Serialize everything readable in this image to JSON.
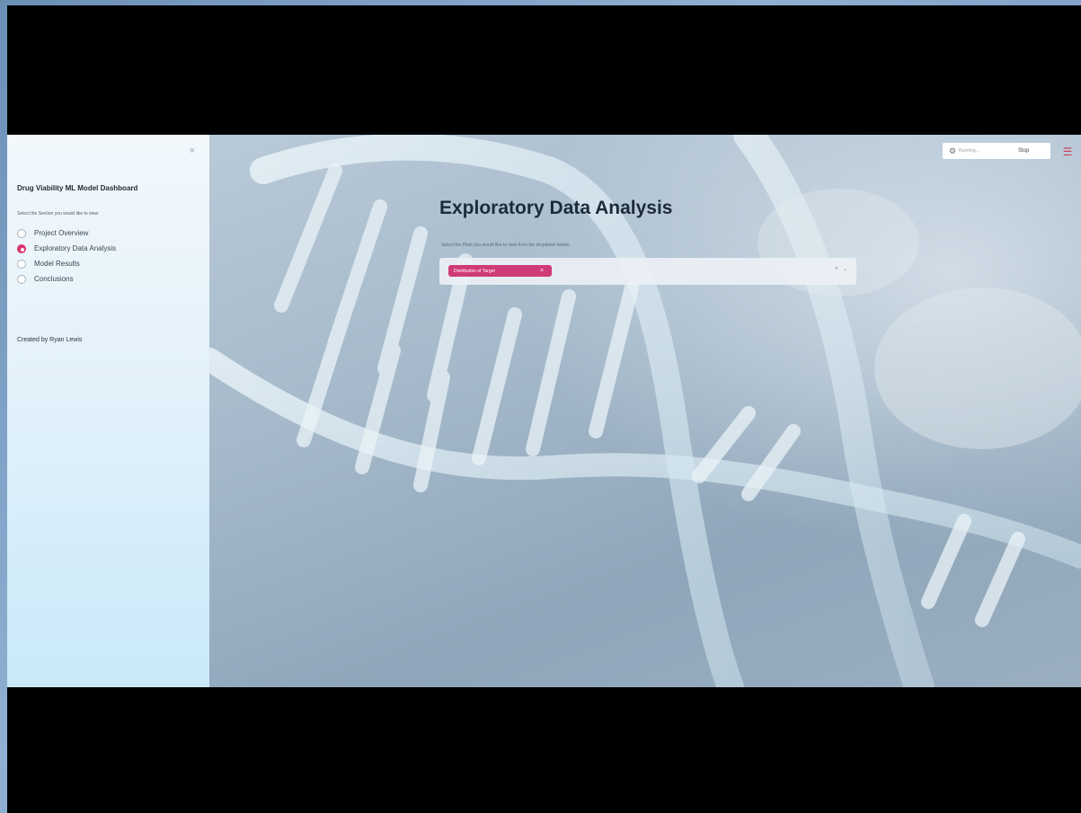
{
  "sidebar": {
    "collapse_glyph": "×",
    "title": "Drug Viability ML Model Dashboard",
    "prompt": "Select the Section you would like to view:",
    "options": [
      {
        "label": "Project Overview",
        "selected": false
      },
      {
        "label": "Exploratory Data Analysis",
        "selected": true
      },
      {
        "label": "Model Results",
        "selected": false
      },
      {
        "label": "Conclusions",
        "selected": false
      }
    ],
    "credit": "Created by Ryan Lewis"
  },
  "main": {
    "title": "Exploratory Data Analysis",
    "caption": "Select the Plots you would like to view from the dropdown below:",
    "multiselect": {
      "chip_label": "Distribution of Target",
      "chip_close": "×",
      "clear_glyph": "×",
      "chevron_glyph": "⌄"
    }
  },
  "toolbar": {
    "status_icon": "running-figure-icon",
    "status_text": "Running...",
    "stop_label": "Stop",
    "menu_glyph": "☰"
  },
  "colors": {
    "accent": "#d9336f",
    "sidebar_bg": "#e3f1fa",
    "title_text": "#1c2b3a"
  }
}
